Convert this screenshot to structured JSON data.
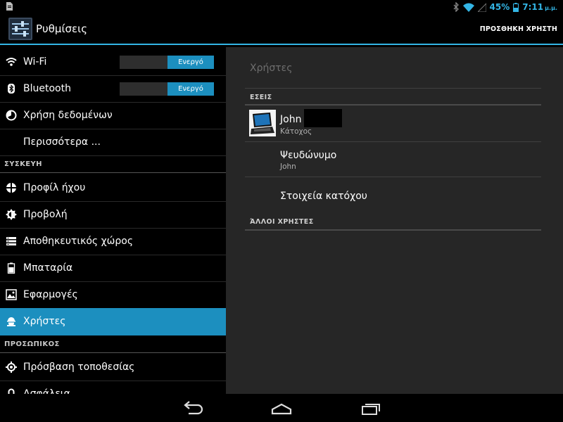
{
  "status_bar": {
    "battery": "45%",
    "time": "7:11",
    "ampm": "μ.μ."
  },
  "action_bar": {
    "title": "Ρυθμίσεις",
    "add_user": "ΠΡΟΣΘΗΚΗ ΧΡΗΣΤΗ"
  },
  "sidebar": {
    "wifi": {
      "label": "Wi-Fi",
      "toggle": "Ενεργό"
    },
    "bluetooth": {
      "label": "Bluetooth",
      "toggle": "Ενεργό"
    },
    "data_usage": "Χρήση δεδομένων",
    "more": "Περισσότερα ...",
    "section_device": "ΣΥΣΚΕΥΗ",
    "sound": "Προφίλ ήχου",
    "display": "Προβολή",
    "storage": "Αποθηκευτικός χώρος",
    "battery": "Μπαταρία",
    "apps": "Εφαρμογές",
    "users": "Χρήστες",
    "section_personal": "ΠΡΟΣΩΠΙΚΟΣ",
    "location": "Πρόσβαση τοποθεσίας",
    "security": "Ασφάλεια"
  },
  "main": {
    "title": "Χρήστες",
    "section_you": "ΕΣΕΙΣ",
    "owner_name": "John",
    "owner_role": "Κάτοχος",
    "nickname_label": "Ψευδώνυμο",
    "nickname_value": "John",
    "owner_info": "Στοιχεία κατόχου",
    "section_other": "ΆΛΛΟΙ ΧΡΗΣΤΕΣ"
  },
  "colors": {
    "accent": "#33b5e5",
    "selected": "#1c8fbf"
  }
}
